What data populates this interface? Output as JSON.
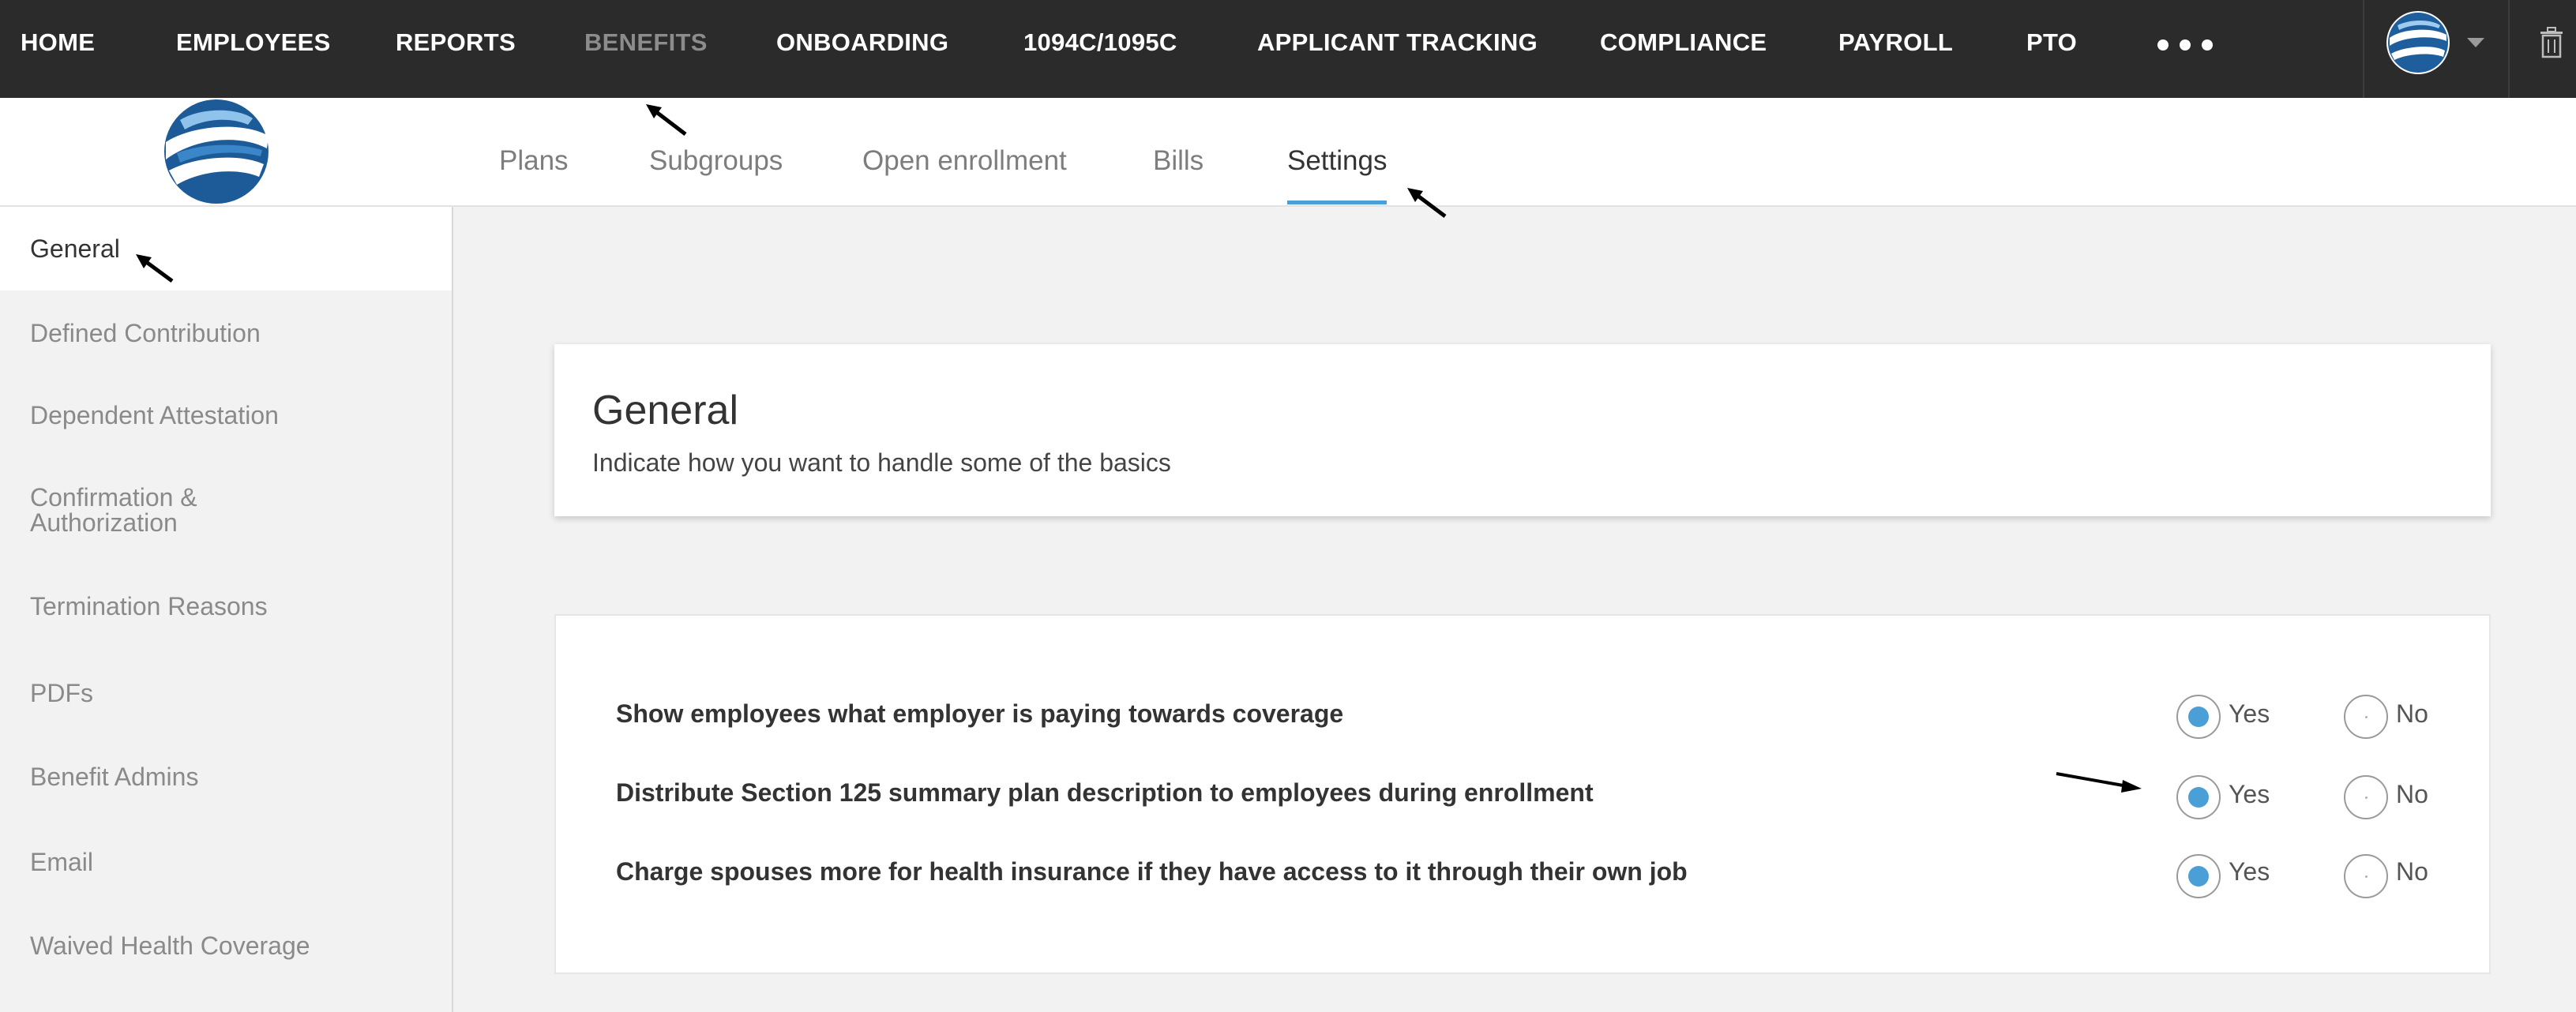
{
  "colors": {
    "nav_bg": "#2b2b2b",
    "nav_active": "#8c8c8c",
    "accent": "#4a9fd6",
    "page_bg": "#f2f2f2"
  },
  "topnav": {
    "items": [
      {
        "label": "HOME",
        "name": "nav-home"
      },
      {
        "label": "EMPLOYEES",
        "name": "nav-employees"
      },
      {
        "label": "REPORTS",
        "name": "nav-reports"
      },
      {
        "label": "BENEFITS",
        "name": "nav-benefits",
        "active": true
      },
      {
        "label": "ONBOARDING",
        "name": "nav-onboarding"
      },
      {
        "label": "1094C/1095C",
        "name": "nav-1094c-1095c"
      },
      {
        "label": "APPLICANT TRACKING",
        "name": "nav-applicant-tracking"
      },
      {
        "label": "COMPLIANCE",
        "name": "nav-compliance"
      },
      {
        "label": "PAYROLL",
        "name": "nav-payroll"
      },
      {
        "label": "PTO",
        "name": "nav-pto"
      }
    ],
    "more_icon": "more-dots-icon",
    "avatar_icon": "globe-logo-icon",
    "menu_icon": "caret-down-icon",
    "trash_icon": "trash-icon"
  },
  "tabs": [
    {
      "label": "Plans",
      "name": "tab-plans"
    },
    {
      "label": "Subgroups",
      "name": "tab-subgroups"
    },
    {
      "label": "Open enrollment",
      "name": "tab-open-enrollment"
    },
    {
      "label": "Bills",
      "name": "tab-bills"
    },
    {
      "label": "Settings",
      "name": "tab-settings",
      "active": true
    }
  ],
  "sidebar": {
    "items": [
      {
        "label": "General",
        "active": true
      },
      {
        "label": "Defined Contribution"
      },
      {
        "label": "Dependent Attestation"
      },
      {
        "label": "Confirmation & Authorization"
      },
      {
        "label": "Termination Reasons"
      },
      {
        "label": "PDFs"
      },
      {
        "label": "Benefit Admins"
      },
      {
        "label": "Email"
      },
      {
        "label": "Waived Health Coverage"
      }
    ]
  },
  "general": {
    "title": "General",
    "subtitle": "Indicate how you want to handle some of the basics"
  },
  "settings": {
    "yes_label": "Yes",
    "no_label": "No",
    "questions": [
      {
        "text": "Show employees what employer is paying towards coverage",
        "value": "Yes"
      },
      {
        "text": "Distribute Section 125 summary plan description to employees during enrollment",
        "value": "Yes"
      },
      {
        "text": "Charge spouses more for health insurance if they have access to it through their own job",
        "value": "Yes"
      }
    ]
  }
}
